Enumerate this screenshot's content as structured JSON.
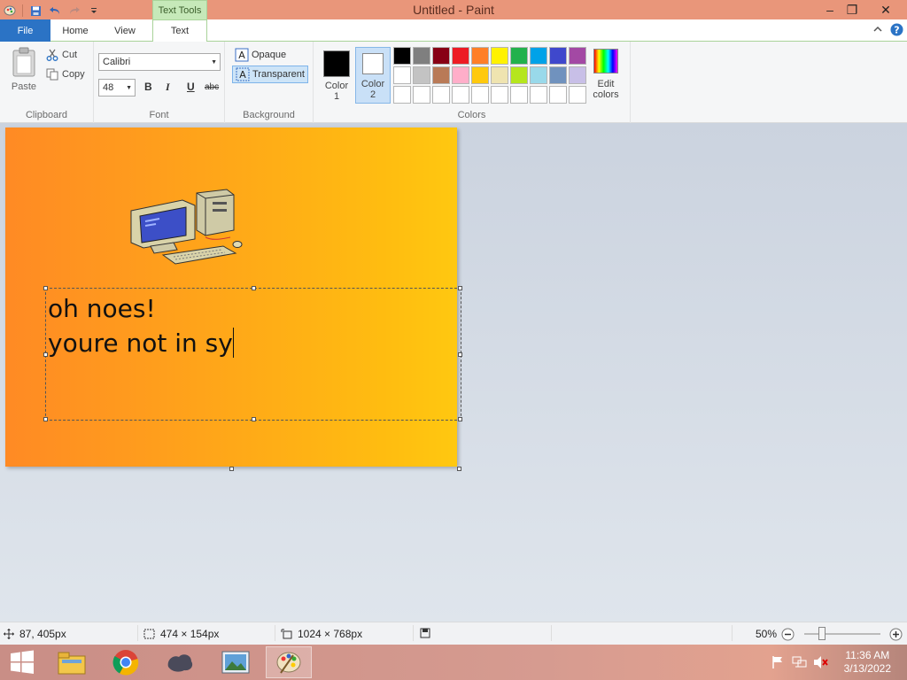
{
  "window": {
    "title": "Untitled - Paint",
    "context_tab": "Text Tools",
    "minimize_glyph": "–",
    "restore_glyph": "❐",
    "close_glyph": "✕"
  },
  "tabs": {
    "file": "File",
    "home": "Home",
    "view": "View",
    "text": "Text"
  },
  "clipboard": {
    "paste": "Paste",
    "cut": "Cut",
    "copy": "Copy",
    "group_label": "Clipboard"
  },
  "font": {
    "family": "Calibri",
    "size": "48",
    "bold": "B",
    "italic": "I",
    "underline": "U",
    "strikethrough": "abc",
    "group_label": "Font"
  },
  "background": {
    "opaque": "Opaque",
    "transparent": "Transparent",
    "group_label": "Background"
  },
  "colors": {
    "color1_label_a": "Color",
    "color1_label_b": "1",
    "color1": "#000000",
    "color2_label_a": "Color",
    "color2_label_b": "2",
    "color2": "#ffffff",
    "edit_label_a": "Edit",
    "edit_label_b": "colors",
    "group_label": "Colors",
    "palette": [
      "#000000",
      "#7f7f7f",
      "#880015",
      "#ed1c24",
      "#ff7f27",
      "#fff200",
      "#22b14c",
      "#00a2e8",
      "#3f48cc",
      "#a349a4",
      "#ffffff",
      "#c3c3c3",
      "#b97a57",
      "#ffaec9",
      "#ffc90e",
      "#efe4b0",
      "#b5e61d",
      "#99d9ea",
      "#7092be",
      "#c8bfe7",
      "#ffffff",
      "#ffffff",
      "#ffffff",
      "#ffffff",
      "#ffffff",
      "#ffffff",
      "#ffffff",
      "#ffffff",
      "#ffffff",
      "#ffffff"
    ]
  },
  "canvas": {
    "text_lines": [
      "oh noes!",
      "youre not in sy"
    ]
  },
  "status": {
    "cursor_pos": "87, 405px",
    "selection_size": "474 × 154px",
    "image_size": "1024 × 768px",
    "zoom": "50%"
  },
  "taskbar": {
    "apps": [
      "windows-start",
      "file-explorer",
      "google-chrome",
      "unknown-app",
      "photo-viewer",
      "paint"
    ],
    "time": "11:36 AM",
    "date": "3/13/2022"
  }
}
